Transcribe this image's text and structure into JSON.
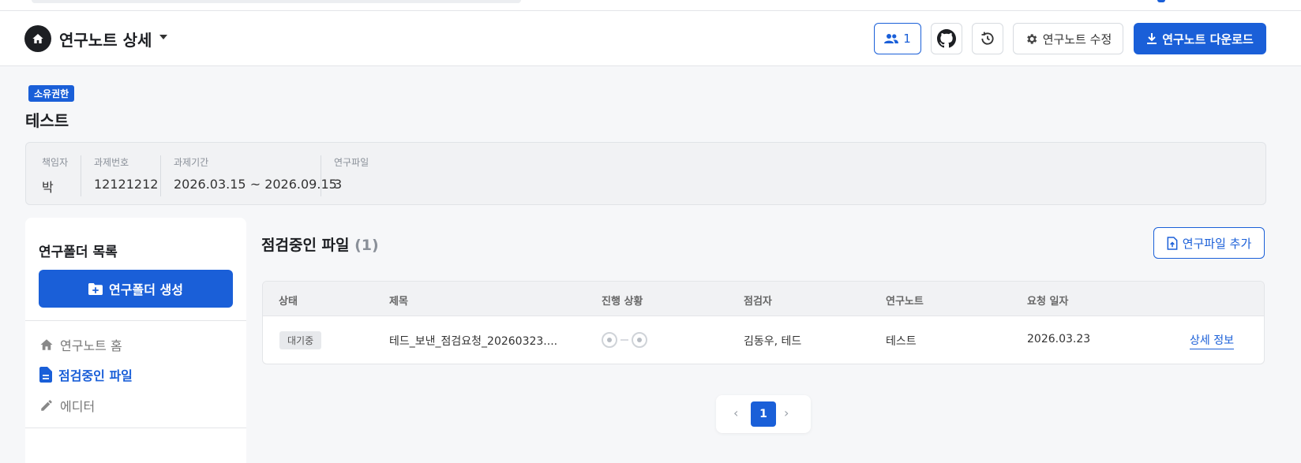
{
  "header": {
    "title": "연구노트 상세",
    "members_count": "1",
    "edit_label": "연구노트 수정",
    "download_label": "연구노트 다운로드"
  },
  "project": {
    "badge": "소유권한",
    "title": "테스트",
    "info": [
      {
        "label": "책임자",
        "value": "박"
      },
      {
        "label": "과제번호",
        "value": "12121212"
      },
      {
        "label": "과제기간",
        "value": "2026.03.15 ~ 2026.09.15"
      },
      {
        "label": "연구파일",
        "value": "3"
      }
    ]
  },
  "sidebar": {
    "title": "연구폴더 목록",
    "create_label": "연구폴더 생성",
    "items": [
      {
        "label": "연구노트 홈",
        "icon": "home-icon"
      },
      {
        "label": "점검중인 파일",
        "icon": "document-icon",
        "active": true
      },
      {
        "label": "에디터",
        "icon": "pencil-icon"
      }
    ]
  },
  "main": {
    "title": "점검중인 파일",
    "count": "(1)",
    "add_label": "연구파일 추가",
    "columns": [
      "상태",
      "제목",
      "진행 상황",
      "점검자",
      "연구노트",
      "요청 일자"
    ],
    "rows": [
      {
        "status": "대기중",
        "title": "테드_보낸_점검요청_20260323....",
        "reviewers": "김동우, 테드",
        "note": "테스트",
        "date": "2026.03.23",
        "detail": "상세 정보"
      }
    ]
  },
  "pagination": {
    "prev": "‹",
    "current": "1",
    "next": "›"
  },
  "colors": {
    "accent": "#1a5fd8",
    "background": "#f6f7f9"
  }
}
